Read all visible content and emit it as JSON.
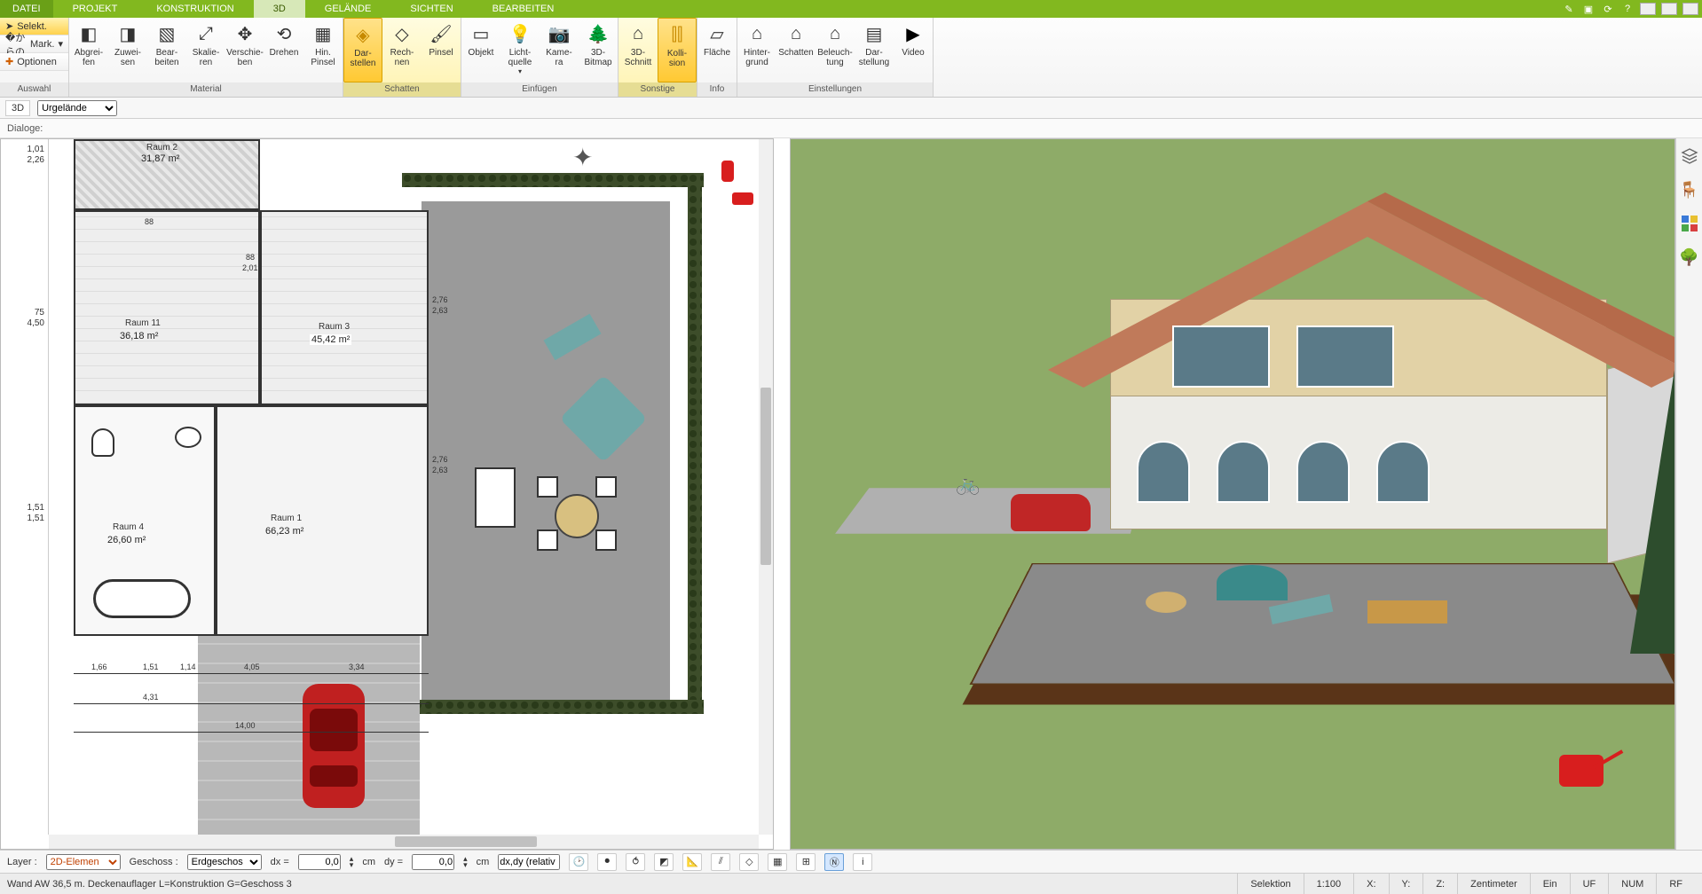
{
  "tabs": {
    "datei": "DATEI",
    "projekt": "PROJEKT",
    "konstruktion": "KONSTRUKTION",
    "d3": "3D",
    "gelaende": "GELÄNDE",
    "sichten": "SICHTEN",
    "bearbeiten": "BEARBEITEN"
  },
  "leftcol": {
    "selekt": "Selekt.",
    "mark": "Mark.",
    "optionen": "Optionen",
    "group": "Auswahl"
  },
  "ribbon": {
    "material": {
      "label": "Material",
      "abgreifen": "Abgrei-\nfen",
      "zuweisen": "Zuwei-\nsen",
      "bearbeiten": "Bear-\nbeiten",
      "skalieren": "Skalie-\nren",
      "verschieben": "Verschie-\nben",
      "drehen": "Drehen",
      "hinpinsel": "Hin.\nPinsel"
    },
    "schatten": {
      "label": "Schatten",
      "darstellen": "Dar-\nstellen",
      "rechnen": "Rech-\nnen",
      "pinsel": "Pinsel"
    },
    "einfuegen": {
      "label": "Einfügen",
      "objekt": "Objekt",
      "lichtquelle": "Licht-\nquelle",
      "kamera": "Kame-\nra",
      "bitmap3d": "3D-\nBitmap"
    },
    "sonstige": {
      "label": "Sonstige",
      "schnitt3d": "3D-\nSchnitt",
      "kollision": "Kolli-\nsion"
    },
    "info": {
      "label": "Info",
      "flaeche": "Fläche"
    },
    "einstellungen": {
      "label": "Einstellungen",
      "hintergrund": "Hinter-\ngrund",
      "schatten": "Schatten",
      "beleuchtung": "Beleuch-\ntung",
      "darstellung": "Dar-\nstellung",
      "video": "Video"
    }
  },
  "secbar": {
    "view_label": "3D",
    "view_value": "Urgelände"
  },
  "dialogbar": {
    "label": "Dialoge:"
  },
  "rooms": {
    "r2": {
      "name": "Raum 2",
      "area": "31,87 m²"
    },
    "r11": {
      "name": "Raum 11",
      "area": "36,18 m²"
    },
    "r3": {
      "name": "Raum 3",
      "area": "45,42 m²"
    },
    "r1": {
      "name": "Raum 1",
      "area": "66,23 m²"
    },
    "r4": {
      "name": "Raum 4",
      "area": "26,60 m²"
    }
  },
  "dims": {
    "d101": "1,01",
    "d226": "2,26",
    "d75": "75",
    "d450": "4,50",
    "d151a": "1,51",
    "d151b": "1,51",
    "d88a": "88",
    "d88b": "88",
    "d201": "2,01",
    "d276a": "2,76",
    "d263a": "2,63",
    "d276b": "2,76",
    "d263b": "2,63",
    "b166": "1,66",
    "b151": "1,51",
    "b114": "1,14",
    "b405": "4,05",
    "b334": "3,34",
    "b431": "4,31",
    "b1400": "14,00"
  },
  "optionsbar": {
    "layer_label": "Layer :",
    "layer_value": "2D-Elemen",
    "geschoss_label": "Geschoss :",
    "geschoss_value": "Erdgeschos",
    "dx_label": "dx =",
    "dx_value": "0,0",
    "dx_unit": "cm",
    "dy_label": "dy =",
    "dy_value": "0,0",
    "dy_unit": "cm",
    "readout": "dx,dy (relativ ka"
  },
  "statusbar": {
    "msg": "Wand AW 36,5 m. Deckenauflager L=Konstruktion G=Geschoss 3",
    "selektion": "Selektion",
    "scale": "1:100",
    "x": "X:",
    "y": "Y:",
    "z": "Z:",
    "unit": "Zentimeter",
    "ein": "Ein",
    "uf": "UF",
    "num": "NUM",
    "rf": "RF"
  },
  "colors": {
    "accent": "#82b81f",
    "highlight": "#ffd24d",
    "car": "#c02020"
  }
}
